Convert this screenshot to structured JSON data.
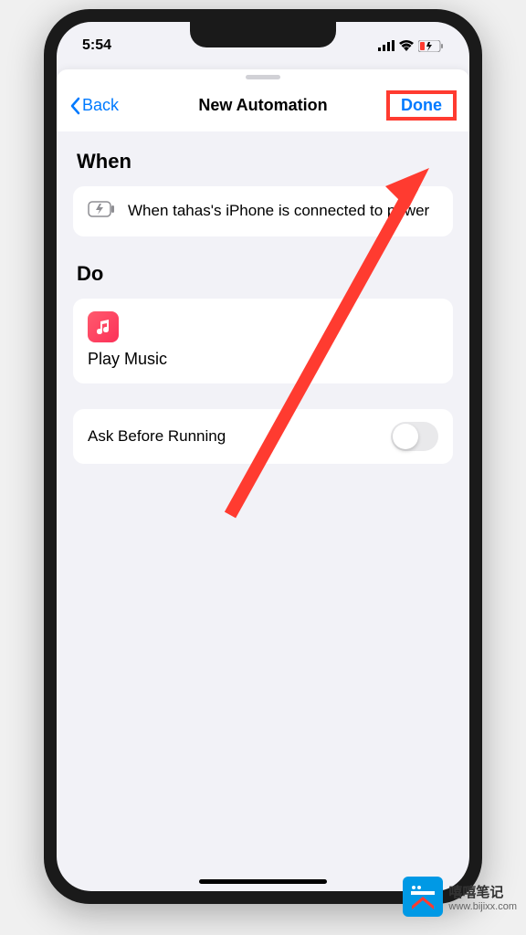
{
  "status": {
    "time": "5:54"
  },
  "nav": {
    "back": "Back",
    "title": "New Automation",
    "done": "Done"
  },
  "sections": {
    "when": {
      "header": "When",
      "condition": "When tahas's iPhone is connected to power"
    },
    "do": {
      "header": "Do",
      "action": "Play Music"
    },
    "ask": {
      "label": "Ask Before Running",
      "enabled": false
    }
  },
  "watermark": {
    "name": "嘻嘻笔记",
    "url": "www.bijixx.com"
  }
}
